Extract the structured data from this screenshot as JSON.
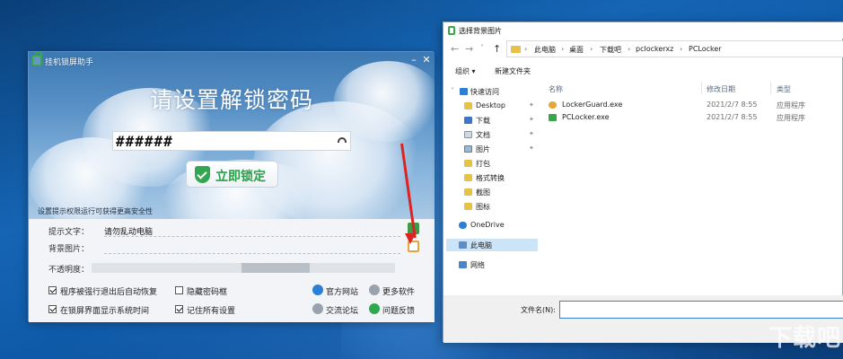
{
  "lock_app": {
    "title": "挂机锁屏助手",
    "heading": "请设置解锁密码",
    "password_mask": "######",
    "lock_button": "立即锁定",
    "tip": "设置提示权限运行可获得更高安全性",
    "hint_label": "提示文字：",
    "hint_value": "请勿乱动电脑",
    "bg_label": "背景图片：",
    "opacity_label": "不透明度：",
    "opacity_level": 0.72,
    "checkboxes": [
      {
        "label": "程序被强行退出后自动恢复",
        "checked": true
      },
      {
        "label": "隐藏密码框",
        "checked": false
      },
      {
        "label": "在锁屏界面显示系统时间",
        "checked": true
      },
      {
        "label": "记住所有设置",
        "checked": true
      }
    ],
    "links": [
      "官方网站",
      "更多软件",
      "交流论坛",
      "问题反馈"
    ]
  },
  "dialog": {
    "title": "选择背景图片",
    "breadcrumbs": [
      "此电脑",
      "桌面",
      "下载吧",
      "pclockerxz",
      "PCLocker"
    ],
    "toolbar": {
      "organize": "组织 ▾",
      "new_folder": "新建文件夹"
    },
    "nav": {
      "quick_access": "快速访问",
      "items": [
        "Desktop",
        "下载",
        "文档",
        "图片",
        "打包",
        "格式转换",
        "截图",
        "图标"
      ],
      "onedrive": "OneDrive",
      "this_pc": "此电脑",
      "network": "网络"
    },
    "columns": {
      "name": "名称",
      "date": "修改日期",
      "type": "类型"
    },
    "files": [
      {
        "name": "LockerGuard.exe",
        "date": "2021/2/7 8:55",
        "type": "应用程序"
      },
      {
        "name": "PCLocker.exe",
        "date": "2021/2/7 8:55",
        "type": "应用程序"
      }
    ],
    "filename_label": "文件名(N):",
    "filename_value": ""
  },
  "watermark": "下载吧"
}
